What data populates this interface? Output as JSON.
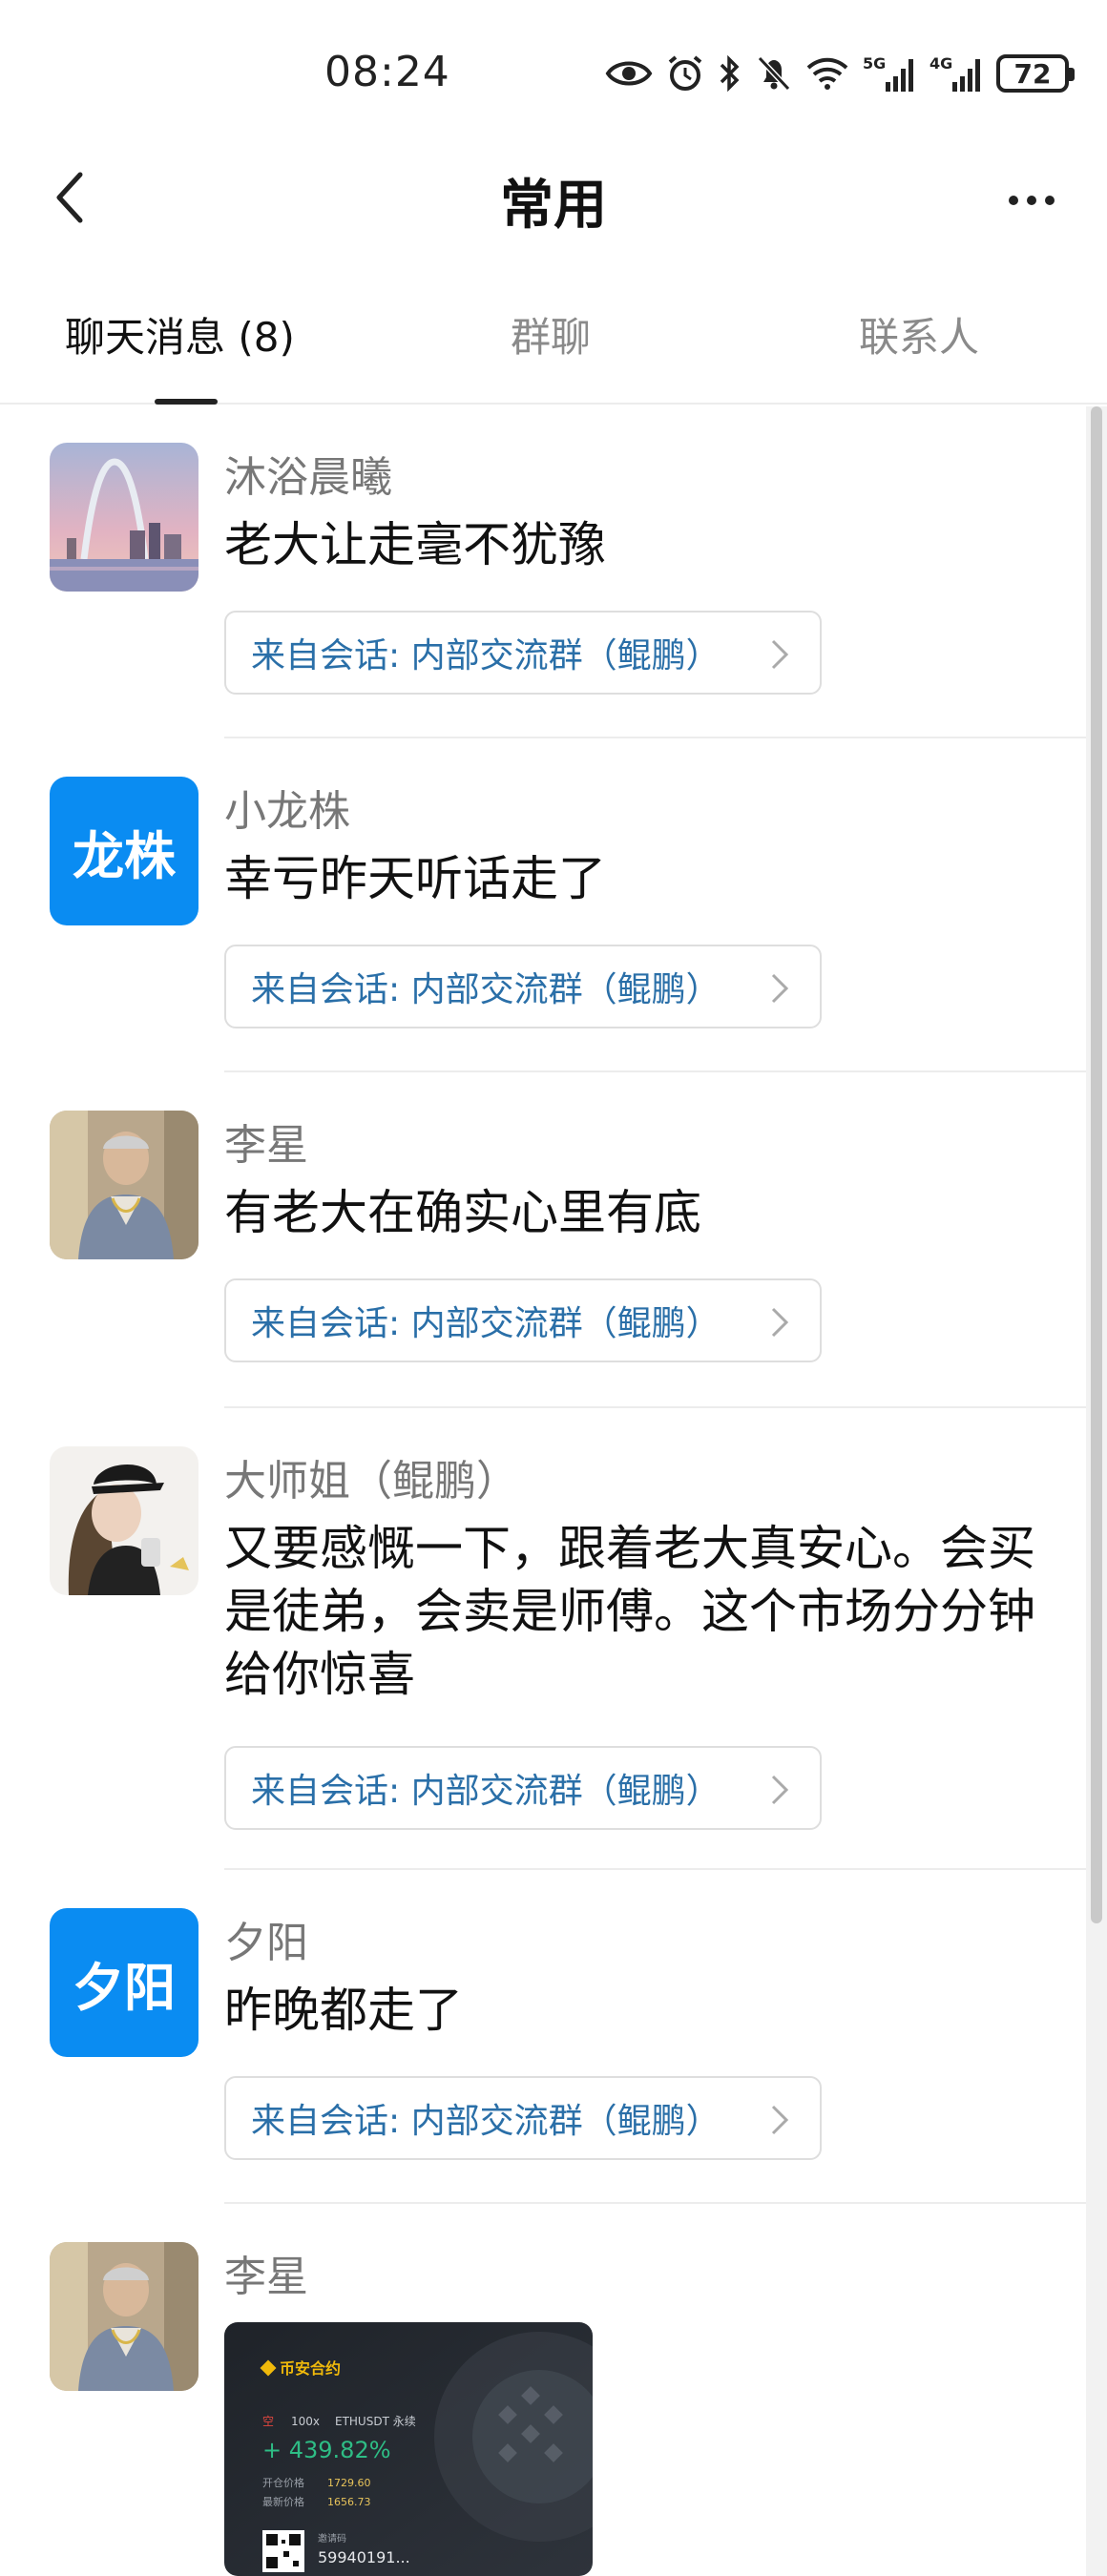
{
  "status_bar": {
    "time": "08:24",
    "battery": "72",
    "network_1": "5G",
    "network_2": "4G",
    "icons": [
      "eye-icon",
      "alarm-icon",
      "bluetooth-icon",
      "mute-bell-icon",
      "wifi-icon",
      "signal-5g-icon",
      "signal-4g-icon",
      "battery-icon"
    ]
  },
  "header": {
    "title": "常用",
    "back_icon": "chevron-left-icon",
    "more_icon": "more-dots-icon"
  },
  "tabs": [
    {
      "label": "聊天消息 (8)",
      "active": true
    },
    {
      "label": "群聊",
      "active": false
    },
    {
      "label": "联系人",
      "active": false
    }
  ],
  "colors": {
    "accent_blue": "#0a8cf2",
    "link_blue": "#2a6fa8",
    "divider": "#ececec"
  },
  "messages": [
    {
      "sender": "沐浴晨曦",
      "text": "老大让走毫不犹豫",
      "source": "来自会话: 内部交流群（鲲鹏）",
      "avatar_text": ""
    },
    {
      "sender": "小龙株",
      "text": "幸亏昨天听话走了",
      "source": "来自会话: 内部交流群（鲲鹏）",
      "avatar_text": "龙株"
    },
    {
      "sender": "李星",
      "text": "有老大在确实心里有底",
      "source": "来自会话: 内部交流群（鲲鹏）",
      "avatar_text": ""
    },
    {
      "sender": "大师姐（鲲鹏）",
      "text": "又要感慨一下，跟着老大真安心。会买是徒弟，会卖是师傅。这个市场分分钟给你惊喜",
      "source": "来自会话: 内部交流群（鲲鹏）",
      "avatar_text": ""
    },
    {
      "sender": "夕阳",
      "text": "昨晚都走了",
      "source": "来自会话: 内部交流群（鲲鹏）",
      "avatar_text": "夕阳"
    },
    {
      "sender": "李星",
      "text": "",
      "source": "",
      "avatar_text": ""
    }
  ],
  "card": {
    "brand": "币安合约",
    "position_tag": "空",
    "leverage": "100x",
    "pair": "ETHUSDT 永续",
    "pnl": "+ 439.82%",
    "entry_label": "开仓价格",
    "entry_price": "1729.60",
    "last_label": "最新价格",
    "last_price": "1656.73",
    "referral_label": "邀请码",
    "referral_code": "59940191..."
  }
}
